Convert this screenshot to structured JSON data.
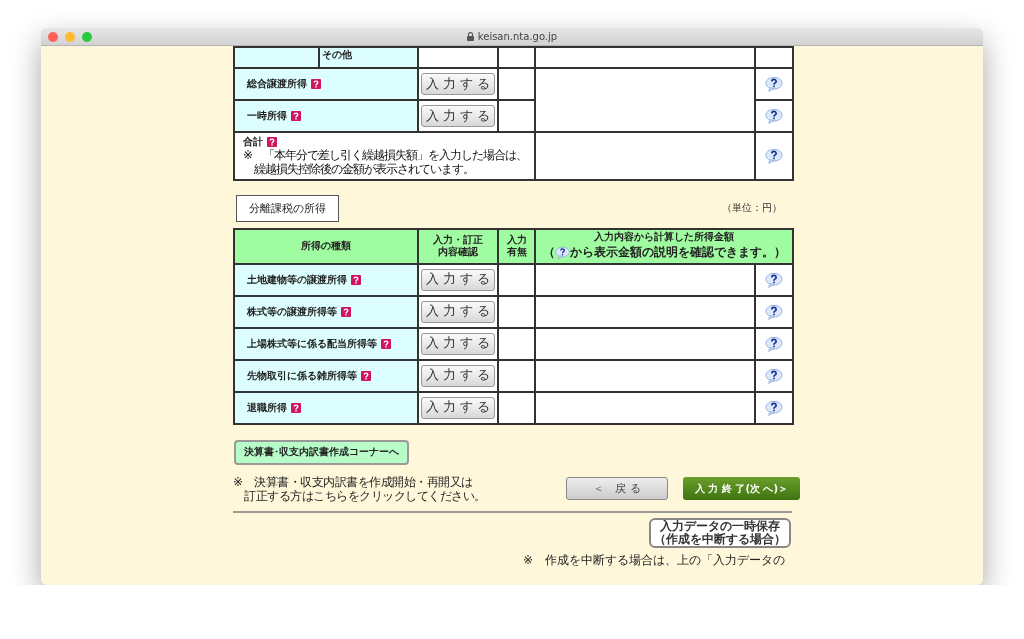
{
  "window": {
    "url": "keisan.nta.go.jp"
  },
  "general_table": {
    "partial_row": {
      "label": "その他"
    },
    "rows": [
      {
        "label": "総合譲渡所得",
        "button": "入 力 す る"
      },
      {
        "label": "一時所得",
        "button": "入 力 す る"
      }
    ],
    "total": {
      "label": "合計",
      "note": [
        "※　「本年分で差し引く繰越損失額」を入力した場合は、",
        "繰越損失控除後の金額が表示されています。"
      ]
    }
  },
  "separate_section": {
    "title": "分離課税の所得",
    "unit": "（単位：円）",
    "columns": [
      [
        "所得の種類"
      ],
      [
        "入力・訂正",
        "内容確認"
      ],
      [
        "入力",
        "有無"
      ]
    ],
    "amount_header": {
      "line1": "入力内容から計算した所得金額",
      "prefix": "（",
      "suffix": "から表示金額の説明を確認できます。）"
    },
    "rows": [
      {
        "label": "土地建物等の譲渡所得",
        "button": "入 力 す る"
      },
      {
        "label": "株式等の譲渡所得等",
        "button": "入 力 す る"
      },
      {
        "label": "上場株式等に係る配当所得等",
        "button": "入 力 す る"
      },
      {
        "label": "先物取引に係る雑所得等",
        "button": "入 力 す る"
      },
      {
        "label": "退職所得",
        "button": "入 力 す る"
      }
    ]
  },
  "footer": {
    "corner_button": "決算書･収支内訳書作成コーナーへ",
    "corner_note": [
      "※　決算書・収支内訳書を作成開始・再開又は",
      "訂正する方はこちらをクリックしてください。"
    ],
    "back_button": "＜　戻 る",
    "next_button": "入 力 終 了(次 へ)＞",
    "save_button": {
      "line1": "入力データの一時保存",
      "line2": "（作成を中断する場合）"
    },
    "bottom_note": "※　作成を中断する場合は、上の「入力データの"
  }
}
